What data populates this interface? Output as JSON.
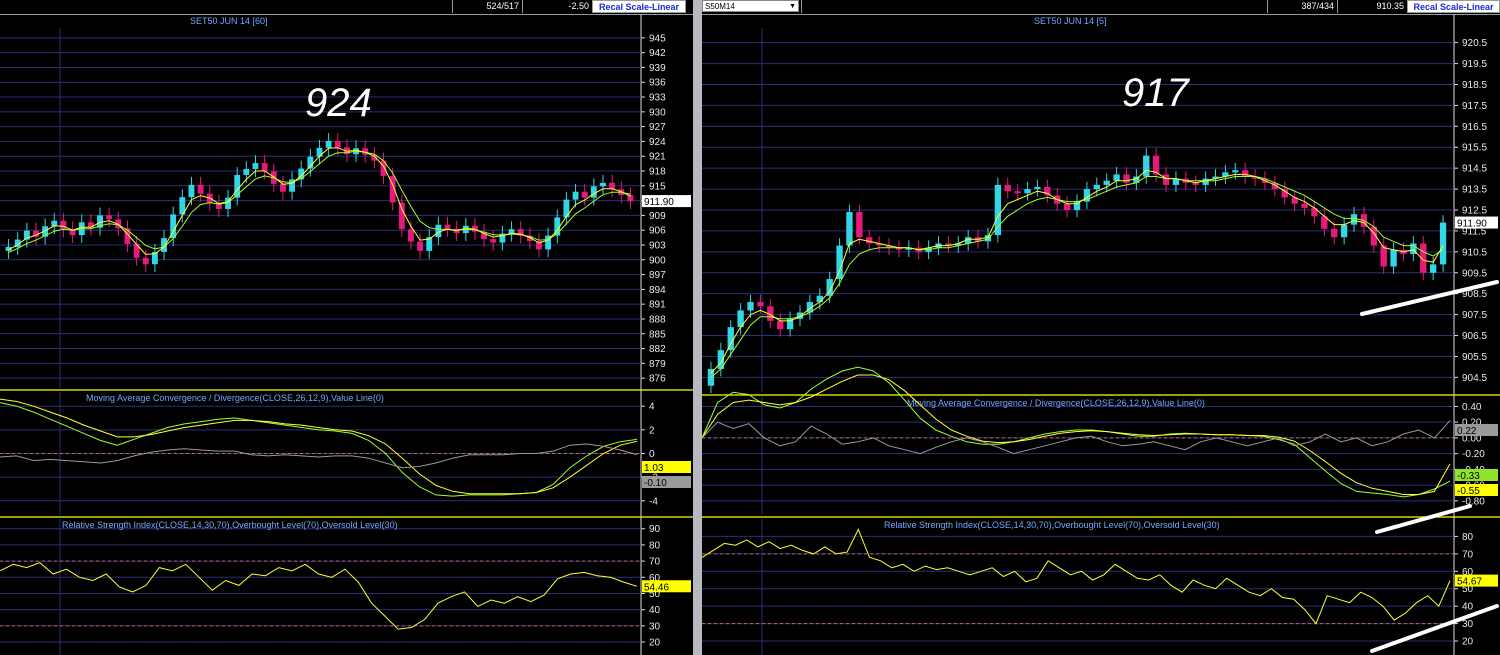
{
  "left": {
    "topbar": {
      "cell1": "524/517",
      "cell2": "-2.50",
      "recal": "Recal Scale-Linear"
    },
    "price": {
      "title": "SET50 JUN 14   [60]",
      "annotation": "924",
      "last_value": "911.90",
      "ticks": [
        "945",
        "942",
        "939",
        "936",
        "933",
        "930",
        "927",
        "924",
        "921",
        "918",
        "915",
        "912",
        "909",
        "906",
        "903",
        "900",
        "897",
        "894",
        "891",
        "888",
        "885",
        "882",
        "879",
        "876"
      ],
      "ylim": [
        874,
        947
      ]
    },
    "macd": {
      "title": "Moving Average Convergence / Divergence(CLOSE,26,12,9),Value Line(0)",
      "ticks": [
        "4",
        "2",
        "0",
        "-2",
        "-4"
      ],
      "ylim": [
        -5.2,
        5.2
      ],
      "badges": [
        {
          "text": "1.03",
          "bg": "#ffff00",
          "fg": "#000000"
        },
        {
          "text": "-0.10",
          "bg": "#9a9a9a",
          "fg": "#000000"
        }
      ]
    },
    "rsi": {
      "title": "Relative Strength Index(CLOSE,14,30,70),Overbought Level(70),Oversold Level(30)",
      "ticks": [
        "90",
        "80",
        "70",
        "60",
        "50",
        "40",
        "30",
        "20"
      ],
      "ylim": [
        12,
        96
      ],
      "badge": {
        "text": "54.46",
        "bg": "#ffff00",
        "fg": "#000000"
      }
    }
  },
  "right": {
    "topbar": {
      "symbol": "S50M14",
      "cell1": "387/434",
      "cell2": "910.35",
      "recal": "Recal Scale-Linear"
    },
    "price": {
      "title": "SET50 JUN 14   [5]",
      "annotation": "917",
      "last_value": "911.90",
      "ticks": [
        "920.5",
        "919.5",
        "918.5",
        "917.5",
        "916.5",
        "915.5",
        "914.5",
        "913.5",
        "912.5",
        "911.5",
        "910.5",
        "909.5",
        "908.5",
        "907.5",
        "906.5",
        "905.5",
        "904.5"
      ],
      "ylim": [
        903.8,
        921.2
      ]
    },
    "macd": {
      "title": "Moving Average Convergence / Divergence(CLOSE,26,12,9),Value Line(0)",
      "ticks": [
        "0.40",
        "0.20",
        "0.00",
        "-0.20",
        "-0.40",
        "-0.60",
        "-0.80"
      ],
      "ylim": [
        -0.98,
        0.52
      ],
      "badges": [
        {
          "text": "0.22",
          "bg": "#9a9a9a",
          "fg": "#000000"
        },
        {
          "text": "-0.33",
          "bg": "#8fe32a",
          "fg": "#000000"
        },
        {
          "text": "-0.55",
          "bg": "#ffff00",
          "fg": "#000000"
        }
      ]
    },
    "rsi": {
      "title": "Relative Strength Index(CLOSE,14,30,70),Overbought Level(70),Oversold Level(30)",
      "ticks": [
        "80",
        "70",
        "60",
        "50",
        "40",
        "30",
        "20"
      ],
      "ylim": [
        12,
        90
      ],
      "badge": {
        "text": "54.67",
        "bg": "#ffff00",
        "fg": "#000000"
      }
    }
  },
  "colors": {
    "up": "#33d6e6",
    "down": "#e8197d",
    "ma_fast": "#ffff33",
    "ma_slow": "#9cff33",
    "grid": "#2d2d7a",
    "axis": "#ffff00",
    "dashed": "#c86464",
    "label": "#6fa8ff"
  },
  "chart_data": [
    {
      "type": "candlestick",
      "title": "SET50 JUN 14   [60]",
      "annotation": "924",
      "close": [
        902.6,
        904.1,
        905.9,
        904.7,
        906.8,
        907.9,
        906.2,
        905.0,
        907.6,
        906.5,
        909.0,
        908.2,
        906.4,
        903.2,
        900.4,
        899.1,
        901.6,
        904.4,
        909.2,
        912.7,
        915.2,
        913.4,
        911.5,
        910.3,
        912.6,
        917.2,
        918.4,
        919.6,
        917.9,
        915.4,
        913.8,
        916.3,
        918.5,
        920.9,
        922.7,
        924.1,
        922.8,
        921.4,
        922.6,
        921.3,
        920.1,
        917.0,
        911.6,
        906.2,
        903.7,
        901.8,
        904.6,
        907.1,
        906.3,
        905.4,
        906.9,
        905.7,
        904.2,
        903.5,
        905.3,
        906.2,
        904.9,
        903.8,
        902.1,
        904.9,
        908.6,
        912.2,
        913.8,
        912.6,
        914.9,
        915.6,
        914.3,
        913.1,
        911.9
      ],
      "ma_fast": [
        902.0,
        903.1,
        904.4,
        905.0,
        905.9,
        906.9,
        906.8,
        906.0,
        906.6,
        906.6,
        907.6,
        907.9,
        907.2,
        905.2,
        903.1,
        901.1,
        901.2,
        902.6,
        905.7,
        909.0,
        912.2,
        913.0,
        912.5,
        911.4,
        911.8,
        914.2,
        916.3,
        918.0,
        918.0,
        916.8,
        915.3,
        915.5,
        917.0,
        919.0,
        921.0,
        922.6,
        922.7,
        922.0,
        922.2,
        921.8,
        921.0,
        919.0,
        915.2,
        910.3,
        906.8,
        904.0,
        904.2,
        905.6,
        906.2,
        905.9,
        906.4,
        906.2,
        905.3,
        904.6,
        904.9,
        905.4,
        905.2,
        904.5,
        903.4,
        904.0,
        906.0,
        908.8,
        911.2,
        912.1,
        913.4,
        914.4,
        914.4,
        913.8,
        912.9
      ],
      "ma_slow": [
        901.5,
        902.3,
        903.3,
        904.0,
        904.9,
        905.8,
        906.2,
        906.0,
        906.3,
        906.3,
        906.9,
        907.3,
        907.1,
        906.0,
        904.5,
        902.9,
        902.2,
        902.6,
        904.3,
        906.8,
        909.6,
        911.2,
        911.6,
        911.3,
        911.6,
        913.2,
        914.8,
        916.4,
        917.0,
        916.6,
        915.8,
        915.7,
        916.5,
        917.9,
        919.5,
        921.0,
        921.7,
        921.7,
        922.0,
        921.8,
        921.4,
        920.1,
        917.6,
        914.1,
        910.8,
        907.8,
        906.5,
        906.2,
        906.2,
        906.0,
        906.2,
        906.1,
        905.6,
        905.1,
        905.0,
        905.2,
        905.1,
        904.7,
        904.0,
        904.1,
        905.3,
        907.3,
        909.3,
        910.5,
        911.9,
        913.2,
        913.7,
        913.7,
        913.3
      ],
      "ylim": [
        874,
        947
      ]
    },
    {
      "type": "line",
      "title": "Moving Average Convergence / Divergence(CLOSE,26,12,9),Value Line(0)",
      "series": [
        {
          "values": [
            4.3,
            4.0,
            3.5,
            2.9,
            2.3,
            1.7,
            1.1,
            0.7,
            1.2,
            1.7,
            2.2,
            2.5,
            2.7,
            2.9,
            3.0,
            2.8,
            2.6,
            2.4,
            2.2,
            2.0,
            1.9,
            1.7,
            1.1,
            0.0,
            -1.6,
            -2.8,
            -3.5,
            -3.6,
            -3.5,
            -3.5,
            -3.5,
            -3.4,
            -3.3,
            -2.6,
            -1.2,
            -0.2,
            0.6,
            1.0,
            1.2
          ]
        },
        {
          "values": [
            4.6,
            4.4,
            4.0,
            3.5,
            3.0,
            2.4,
            1.9,
            1.4,
            1.4,
            1.6,
            1.9,
            2.2,
            2.4,
            2.6,
            2.8,
            2.8,
            2.7,
            2.5,
            2.4,
            2.2,
            2.0,
            1.9,
            1.5,
            0.8,
            -0.4,
            -1.7,
            -2.7,
            -3.2,
            -3.4,
            -3.4,
            -3.4,
            -3.4,
            -3.3,
            -2.9,
            -2.0,
            -1.0,
            0.0,
            0.7,
            1.03
          ]
        },
        {
          "values": [
            -0.3,
            -0.2,
            -0.6,
            -0.5,
            -0.6,
            -0.7,
            -0.8,
            -0.6,
            -0.2,
            0.1,
            0.3,
            0.4,
            0.3,
            0.2,
            0.2,
            -0.1,
            -0.2,
            -0.1,
            -0.2,
            -0.3,
            -0.2,
            -0.2,
            -0.4,
            -0.8,
            -1.2,
            -1.1,
            -0.8,
            -0.4,
            -0.1,
            -0.1,
            -0.1,
            0.0,
            0.0,
            0.2,
            0.7,
            0.8,
            0.6,
            0.3,
            -0.1
          ]
        }
      ],
      "ylim": [
        -5.2,
        5.2
      ]
    },
    {
      "type": "line",
      "title": "Relative Strength Index(CLOSE,14,30,70),Overbought Level(70),Oversold Level(30)",
      "series": [
        {
          "values": [
            64,
            68,
            66,
            69,
            62,
            65,
            60,
            58,
            62,
            54,
            51,
            55,
            66,
            64,
            68,
            60,
            52,
            58,
            55,
            62,
            61,
            66,
            64,
            68,
            62,
            60,
            65,
            57,
            44,
            36,
            28,
            29,
            34,
            44,
            48,
            51,
            42,
            46,
            44,
            48,
            45,
            49,
            59,
            62,
            63,
            61,
            60,
            57,
            54.46
          ]
        }
      ],
      "ylim": [
        12,
        96
      ]
    },
    {
      "type": "candlestick",
      "title": "SET50 JUN 14   [5]",
      "annotation": "917",
      "close": [
        904.9,
        905.8,
        906.9,
        907.7,
        908.1,
        907.9,
        907.2,
        906.8,
        907.3,
        907.6,
        908.1,
        908.4,
        909.2,
        910.8,
        912.4,
        911.2,
        910.9,
        910.8,
        910.7,
        910.6,
        910.7,
        910.5,
        910.7,
        910.9,
        910.8,
        910.9,
        911.2,
        911.0,
        911.3,
        913.7,
        913.4,
        913.3,
        913.5,
        913.6,
        913.2,
        912.8,
        912.5,
        912.9,
        913.5,
        913.7,
        913.9,
        914.2,
        913.8,
        914.1,
        915.1,
        914.2,
        913.7,
        914.0,
        913.8,
        913.7,
        914.0,
        914.1,
        914.3,
        914.4,
        914.1,
        914.0,
        913.8,
        913.5,
        913.1,
        912.8,
        912.6,
        912.2,
        911.6,
        911.2,
        911.8,
        912.3,
        911.7,
        910.8,
        909.8,
        910.6,
        910.4,
        910.9,
        909.5,
        909.9,
        911.9
      ],
      "ma_fast": [
        904.7,
        905.2,
        906.1,
        906.9,
        907.5,
        907.7,
        907.5,
        907.2,
        907.2,
        907.4,
        907.8,
        908.1,
        908.6,
        909.6,
        910.9,
        911.1,
        911.0,
        910.9,
        910.8,
        910.7,
        910.7,
        910.6,
        910.7,
        910.8,
        910.8,
        910.9,
        911.1,
        911.1,
        911.2,
        912.2,
        912.8,
        913.0,
        913.2,
        913.4,
        913.3,
        913.0,
        912.8,
        912.8,
        913.1,
        913.4,
        913.6,
        913.9,
        913.9,
        914.0,
        914.4,
        914.3,
        914.0,
        914.0,
        913.9,
        913.8,
        913.9,
        914.0,
        914.1,
        914.2,
        914.2,
        914.1,
        913.9,
        913.7,
        913.4,
        913.1,
        912.9,
        912.6,
        912.2,
        911.8,
        911.8,
        912.0,
        911.9,
        911.4,
        910.7,
        910.6,
        910.5,
        910.6,
        910.1,
        910.0,
        910.8
      ],
      "ma_slow": [
        904.5,
        904.9,
        905.6,
        906.3,
        907.0,
        907.4,
        907.4,
        907.3,
        907.3,
        907.4,
        907.6,
        907.9,
        908.3,
        909.0,
        909.9,
        910.4,
        910.6,
        910.7,
        910.7,
        910.7,
        910.7,
        910.6,
        910.6,
        910.7,
        910.7,
        910.8,
        910.9,
        911.0,
        911.1,
        911.7,
        912.2,
        912.5,
        912.8,
        913.0,
        913.1,
        913.0,
        912.9,
        912.9,
        913.0,
        913.2,
        913.4,
        913.6,
        913.7,
        913.8,
        914.1,
        914.1,
        914.0,
        914.0,
        913.9,
        913.9,
        913.9,
        913.9,
        914.0,
        914.1,
        914.1,
        914.1,
        914.0,
        913.8,
        913.6,
        913.4,
        913.2,
        912.9,
        912.6,
        912.3,
        912.1,
        912.1,
        912.0,
        911.7,
        911.2,
        911.0,
        910.8,
        910.8,
        910.5,
        910.3,
        910.6
      ],
      "ylim": [
        903.8,
        921.2
      ]
    },
    {
      "type": "line",
      "title": "Moving Average Convergence / Divergence(CLOSE,26,12,9),Value Line(0)",
      "series": [
        {
          "values": [
            0.0,
            0.45,
            0.58,
            0.55,
            0.42,
            0.38,
            0.45,
            0.62,
            0.75,
            0.85,
            0.9,
            0.85,
            0.7,
            0.48,
            0.25,
            0.1,
            0.02,
            -0.05,
            -0.08,
            -0.08,
            -0.05,
            0.0,
            0.05,
            0.08,
            0.1,
            0.1,
            0.08,
            0.05,
            0.02,
            0.02,
            0.05,
            0.06,
            0.05,
            0.04,
            0.04,
            0.03,
            0.02,
            -0.02,
            -0.08,
            -0.25,
            -0.42,
            -0.58,
            -0.68,
            -0.7,
            -0.72,
            -0.75,
            -0.72,
            -0.65,
            -0.55
          ]
        },
        {
          "values": [
            0.0,
            0.3,
            0.45,
            0.48,
            0.45,
            0.42,
            0.45,
            0.52,
            0.62,
            0.72,
            0.8,
            0.8,
            0.74,
            0.6,
            0.42,
            0.24,
            0.1,
            0.02,
            -0.04,
            -0.06,
            -0.05,
            -0.02,
            0.02,
            0.06,
            0.08,
            0.09,
            0.08,
            0.06,
            0.04,
            0.03,
            0.04,
            0.05,
            0.05,
            0.04,
            0.04,
            0.03,
            0.03,
            0.01,
            -0.04,
            -0.16,
            -0.3,
            -0.45,
            -0.57,
            -0.64,
            -0.68,
            -0.72,
            -0.72,
            -0.68,
            -0.33
          ]
        },
        {
          "values": [
            0.0,
            0.2,
            0.12,
            0.18,
            0.0,
            -0.1,
            -0.05,
            0.15,
            0.05,
            -0.08,
            -0.05,
            0.0,
            -0.1,
            -0.15,
            -0.2,
            -0.12,
            -0.05,
            0.0,
            -0.05,
            -0.12,
            -0.2,
            -0.15,
            -0.1,
            -0.05,
            0.0,
            0.02,
            -0.05,
            -0.1,
            -0.08,
            -0.05,
            -0.1,
            -0.15,
            -0.05,
            0.0,
            -0.05,
            -0.1,
            -0.05,
            0.0,
            -0.1,
            -0.05,
            0.05,
            -0.05,
            0.0,
            -0.1,
            -0.05,
            0.05,
            0.1,
            0.0,
            0.22
          ]
        }
      ],
      "ylim": [
        -0.98,
        0.52
      ]
    },
    {
      "type": "line",
      "title": "Relative Strength Index(CLOSE,14,30,70),Overbought Level(70),Oversold Level(30)",
      "series": [
        {
          "values": [
            68,
            72,
            76,
            75,
            78,
            74,
            77,
            73,
            75,
            72,
            70,
            74,
            70,
            71,
            84,
            68,
            66,
            62,
            64,
            60,
            63,
            61,
            62,
            60,
            58,
            60,
            62,
            57,
            60,
            54,
            56,
            66,
            62,
            58,
            60,
            55,
            58,
            64,
            60,
            56,
            55,
            58,
            52,
            48,
            55,
            52,
            50,
            56,
            52,
            48,
            46,
            50,
            45,
            44,
            38,
            30,
            46,
            44,
            42,
            48,
            45,
            40,
            32,
            36,
            42,
            46,
            40,
            54.67
          ]
        }
      ],
      "ylim": [
        12,
        90
      ]
    }
  ]
}
